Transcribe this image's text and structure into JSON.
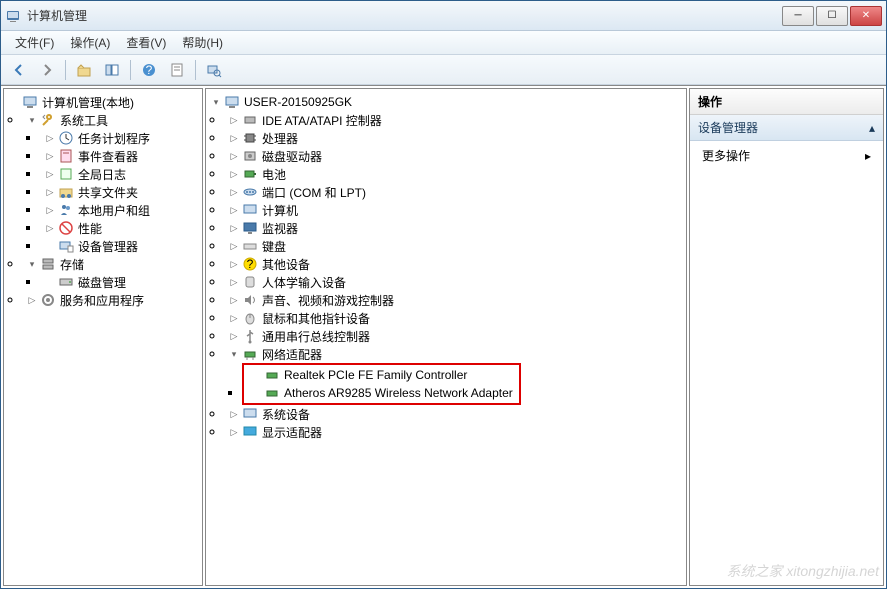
{
  "window": {
    "title": "计算机管理"
  },
  "menus": {
    "file": "文件(F)",
    "action": "操作(A)",
    "view": "查看(V)",
    "help": "帮助(H)"
  },
  "left_tree": {
    "root": "计算机管理(本地)",
    "system_tools": "系统工具",
    "task_scheduler": "任务计划程序",
    "event_viewer": "事件查看器",
    "global_log": "全局日志",
    "shared_folders": "共享文件夹",
    "local_users": "本地用户和组",
    "performance": "性能",
    "device_manager": "设备管理器",
    "storage": "存储",
    "disk_mgmt": "磁盘管理",
    "services_apps": "服务和应用程序"
  },
  "mid_tree": {
    "computer": "USER-20150925GK",
    "ide": "IDE ATA/ATAPI 控制器",
    "processor": "处理器",
    "disk_drive": "磁盘驱动器",
    "battery": "电池",
    "ports": "端口 (COM 和 LPT)",
    "computers": "计算机",
    "monitor": "监视器",
    "keyboard": "键盘",
    "other": "其他设备",
    "hid": "人体学输入设备",
    "sound": "声音、视频和游戏控制器",
    "mouse": "鼠标和其他指针设备",
    "usb": "通用串行总线控制器",
    "network": "网络适配器",
    "net_item1": "Realtek PCIe FE Family Controller",
    "net_item2": "Atheros AR9285 Wireless Network Adapter",
    "system_dev": "系统设备",
    "display": "显示适配器"
  },
  "right_panel": {
    "header": "操作",
    "section": "设备管理器",
    "more": "更多操作"
  },
  "watermark": "系统之家 xitongzhijia.net"
}
